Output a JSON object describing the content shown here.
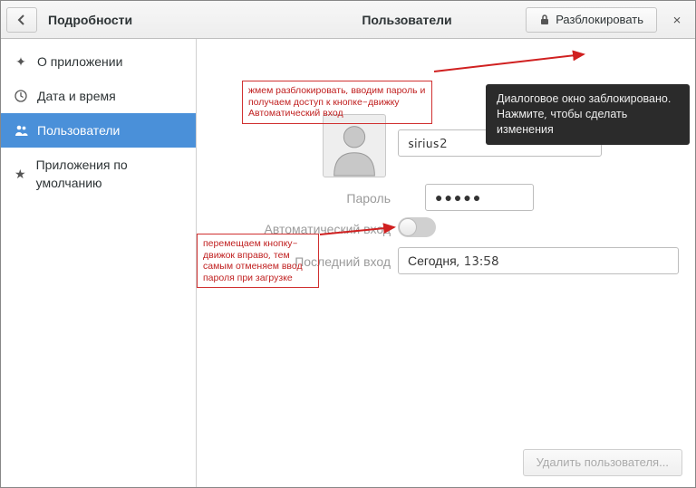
{
  "titlebar": {
    "left_title": "Подробности",
    "center_title": "Пользователи",
    "unlock_label": "Разблокировать",
    "close_glyph": "×"
  },
  "sidebar": {
    "items": [
      {
        "label": "О приложении"
      },
      {
        "label": "Дата и время"
      },
      {
        "label": "Пользователи"
      },
      {
        "label": "Приложения по умолчанию"
      }
    ]
  },
  "user": {
    "name": "sirius2",
    "password_label": "Пароль",
    "password_mask": "●●●●●",
    "auto_login_label": "Автоматический вход",
    "last_login_label": "Последний вход",
    "last_login_value": "Сегодня, 13:58"
  },
  "footer": {
    "delete_label": "Удалить пользователя…"
  },
  "tooltip": {
    "line1": "Диалоговое окно заблокировано.",
    "line2": "Нажмите, чтобы сделать изменения"
  },
  "annotations": {
    "a1": "жмем разблокировать, вводим пароль и получаем доступ к кнопке-движку Автоматический вход",
    "a2": "перемещаем кнопку-движок вправо, тем самым отменяем ввод пароля при загрузке"
  }
}
